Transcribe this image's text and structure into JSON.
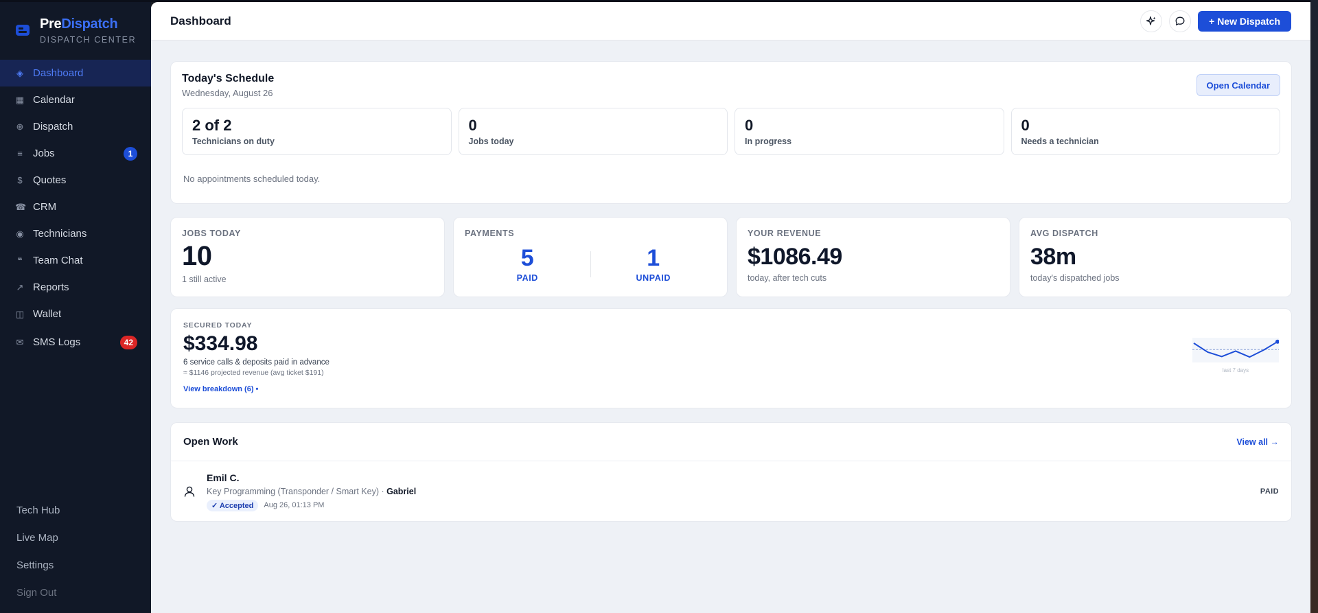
{
  "brand": {
    "name_first": "Pre",
    "name_second": "Dispatch",
    "subtitle": "DISPATCH CENTER"
  },
  "sidebar": {
    "items": [
      {
        "label": "Dashboard",
        "icon": "diamond-icon",
        "active": true
      },
      {
        "label": "Calendar",
        "icon": "calendar-grid-icon"
      },
      {
        "label": "Dispatch",
        "icon": "plus-circle-icon"
      },
      {
        "label": "Jobs",
        "icon": "list-icon",
        "badge": "1"
      },
      {
        "label": "Quotes",
        "icon": "dollar-icon"
      },
      {
        "label": "CRM",
        "icon": "phone-icon"
      },
      {
        "label": "Technicians",
        "icon": "user-circle-icon"
      },
      {
        "label": "Team Chat",
        "icon": "quote-icon"
      },
      {
        "label": "Reports",
        "icon": "trend-arrow-icon"
      },
      {
        "label": "Wallet",
        "icon": "wallet-icon"
      },
      {
        "label": "SMS Logs",
        "icon": "mail-icon",
        "badge": "42"
      }
    ],
    "bottom": [
      {
        "label": "Tech Hub"
      },
      {
        "label": "Live Map"
      },
      {
        "label": "Settings"
      },
      {
        "label": "Sign Out"
      }
    ]
  },
  "topbar": {
    "title": "Dashboard",
    "new_label": "+ New Dispatch"
  },
  "schedule": {
    "title": "Today's Schedule",
    "date": "Wednesday, August 26",
    "open_calendar": "Open Calendar",
    "stats": [
      {
        "value": "2 of 2",
        "label": "Technicians on duty"
      },
      {
        "value": "0",
        "label": "Jobs today"
      },
      {
        "value": "0",
        "label": "In progress"
      },
      {
        "value": "0",
        "label": "Needs a technician"
      }
    ],
    "empty": "No appointments scheduled today."
  },
  "kpis": {
    "jobs": {
      "label": "JOBS TODAY",
      "value": "10",
      "sub": "1 still active"
    },
    "payments": {
      "label": "PAYMENTS",
      "paid": "5",
      "paid_label": "PAID",
      "unpaid": "1",
      "unpaid_label": "UNPAID"
    },
    "revenue": {
      "label": "YOUR REVENUE",
      "value": "$1086.49",
      "sub": "today, after tech cuts"
    },
    "dispatch": {
      "label": "AVG DISPATCH",
      "value": "38m",
      "sub": "today's dispatched jobs"
    }
  },
  "secured": {
    "label": "SECURED TODAY",
    "value": "$334.98",
    "line1": "6 service calls & deposits paid in advance",
    "line2": "≈ $1146 projected revenue (avg ticket $191)",
    "link": "View breakdown (6) •",
    "spark_caption": "last 7 days",
    "spark_values": [
      0.78,
      0.42,
      0.24,
      0.46,
      0.22,
      0.5,
      0.84
    ],
    "spark_avg": 0.52
  },
  "open_work": {
    "title": "Open Work",
    "view_all": "View all →",
    "rows": [
      {
        "name": "Emil C.",
        "service": "Key Programming (Transponder / Smart Key)",
        "separator": " · ",
        "tech": "Gabriel",
        "status": "✓ Accepted",
        "time": "Aug 26, 01:13 PM",
        "payment": "PAID"
      }
    ]
  },
  "colors": {
    "accent": "#1d4ed8",
    "sidebar": "#111827",
    "danger": "#dc2626"
  }
}
